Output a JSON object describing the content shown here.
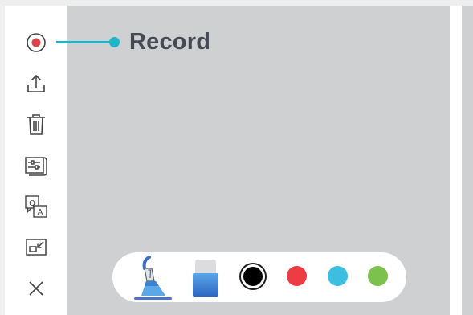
{
  "sidebar": {
    "items": [
      {
        "name": "record",
        "icon": "record-icon"
      },
      {
        "name": "share",
        "icon": "share-upload-icon"
      },
      {
        "name": "delete",
        "icon": "trash-icon"
      },
      {
        "name": "settings",
        "icon": "settings-sliders-icon"
      },
      {
        "name": "qa",
        "icon": "qa-icon"
      },
      {
        "name": "minimize",
        "icon": "minimize-window-icon"
      },
      {
        "name": "close",
        "icon": "close-icon"
      }
    ]
  },
  "callout": {
    "label": "Record",
    "color": "#1fb5c9"
  },
  "toolbar": {
    "tools": [
      {
        "name": "pen",
        "icon": "pen-icon",
        "selected": true
      },
      {
        "name": "eraser",
        "icon": "eraser-icon",
        "selected": false
      }
    ],
    "colors": [
      "#000000",
      "#ee3c45",
      "#3cbee0",
      "#7cc04e"
    ],
    "selected_color": "#000000"
  }
}
